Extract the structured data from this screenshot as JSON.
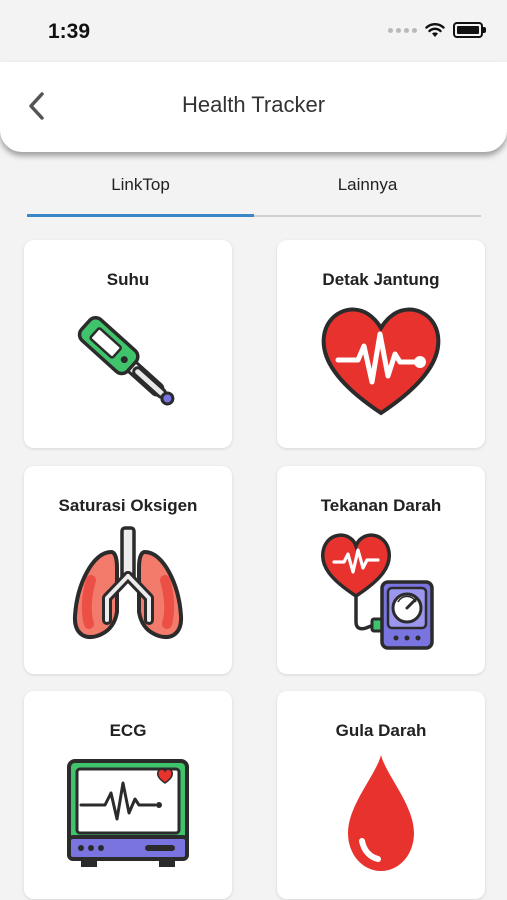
{
  "status_bar": {
    "time": "1:39"
  },
  "header": {
    "title": "Health Tracker"
  },
  "tabs": [
    {
      "label": "LinkTop",
      "active": true
    },
    {
      "label": "Lainnya",
      "active": false
    }
  ],
  "colors": {
    "accent": "#3a86c8",
    "primary_red": "#e8322d",
    "green": "#3fc46b",
    "purple": "#6c6fd6"
  },
  "cards": [
    {
      "title": "Suhu",
      "icon": "thermometer-icon"
    },
    {
      "title": "Detak Jantung",
      "icon": "heart-rate-icon"
    },
    {
      "title": "Saturasi Oksigen",
      "icon": "lungs-icon"
    },
    {
      "title": "Tekanan Darah",
      "icon": "blood-pressure-icon"
    },
    {
      "title": "ECG",
      "icon": "ecg-monitor-icon"
    },
    {
      "title": "Gula Darah",
      "icon": "blood-drop-icon"
    }
  ]
}
